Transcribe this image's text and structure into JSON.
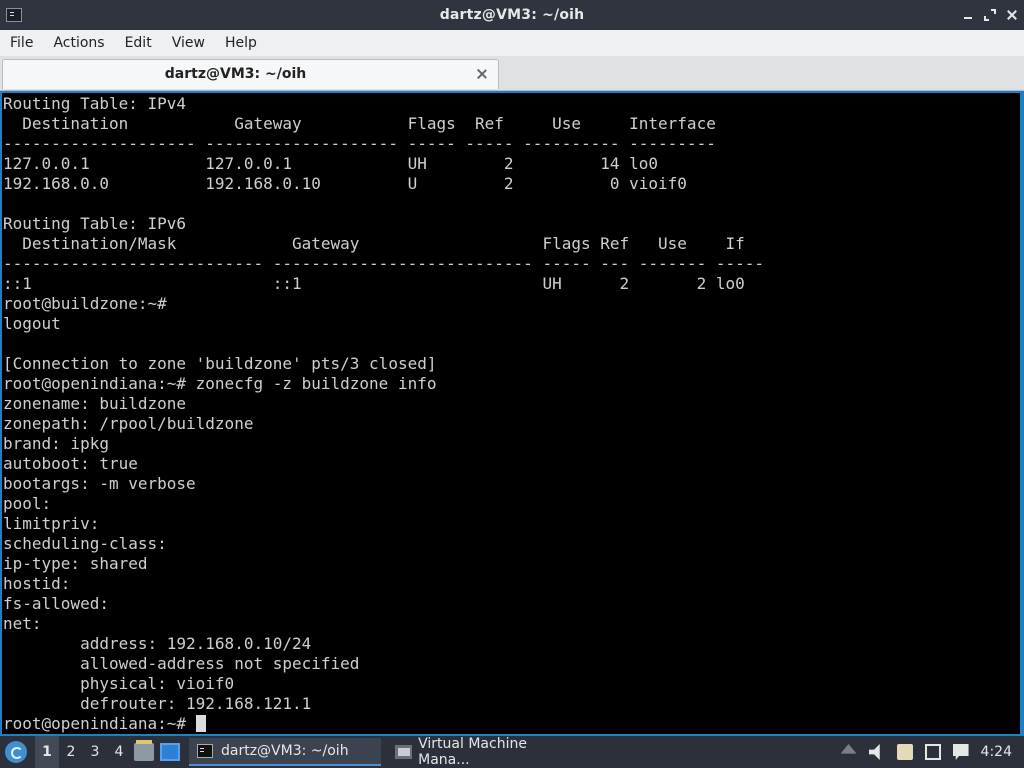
{
  "window": {
    "title": "dartz@VM3: ~/oih"
  },
  "menu": [
    "File",
    "Actions",
    "Edit",
    "View",
    "Help"
  ],
  "tab": {
    "label": "dartz@VM3: ~/oih"
  },
  "terminal": {
    "lines": [
      "Routing Table: IPv4",
      "  Destination           Gateway           Flags  Ref     Use     Interface",
      "-------------------- -------------------- ----- ----- ---------- ---------",
      "127.0.0.1            127.0.0.1            UH        2         14 lo0",
      "192.168.0.0          192.168.0.10         U         2          0 vioif0",
      "",
      "Routing Table: IPv6",
      "  Destination/Mask            Gateway                   Flags Ref   Use    If",
      "--------------------------- --------------------------- ----- --- ------- -----",
      "::1                         ::1                         UH      2       2 lo0",
      "root@buildzone:~#",
      "logout",
      "",
      "[Connection to zone 'buildzone' pts/3 closed]",
      "root@openindiana:~# zonecfg -z buildzone info",
      "zonename: buildzone",
      "zonepath: /rpool/buildzone",
      "brand: ipkg",
      "autoboot: true",
      "bootargs: -m verbose",
      "pool:",
      "limitpriv:",
      "scheduling-class:",
      "ip-type: shared",
      "hostid:",
      "fs-allowed:",
      "net:",
      "        address: 192.168.0.10/24",
      "        allowed-address not specified",
      "        physical: vioif0",
      "        defrouter: 192.168.121.1"
    ],
    "prompt": "root@openindiana:~# "
  },
  "taskbar": {
    "workspaces": [
      "1",
      "2",
      "3",
      "4"
    ],
    "active_workspace": "1",
    "tasks": [
      {
        "label": "dartz@VM3: ~/oih",
        "icon": "terminal-icon",
        "active": true
      },
      {
        "label": "Virtual Machine Mana...",
        "icon": "virtual-machine-manager-icon",
        "active": false
      }
    ],
    "clock": "4:24"
  },
  "colors": {
    "terminal_bg": "#000000",
    "terminal_fg": "#cfcfcf",
    "accent": "#1f7fc4",
    "titlebar": "#2f343f",
    "taskbar": "#2b303b"
  }
}
